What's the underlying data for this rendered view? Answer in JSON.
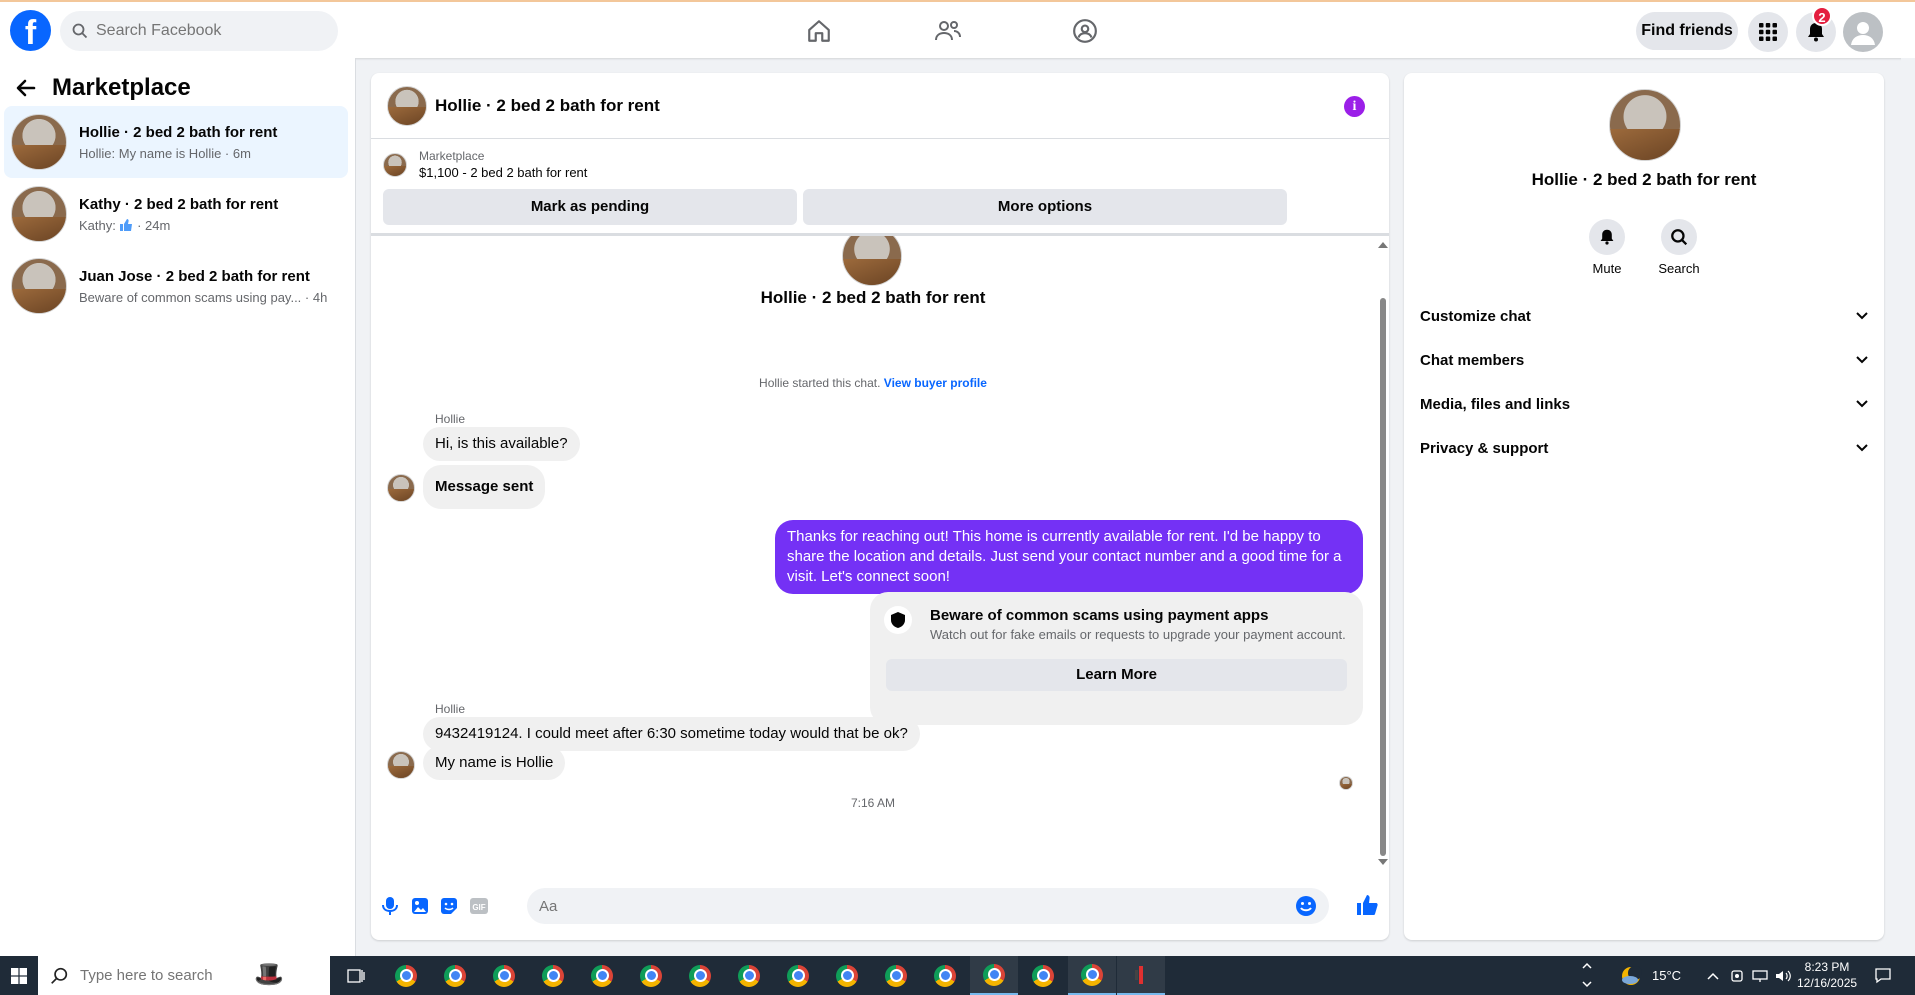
{
  "topbar": {
    "logo": "f",
    "search_placeholder": "Search Facebook",
    "find_friends": "Find friends",
    "notification_count": "2"
  },
  "sidebar": {
    "title": "Marketplace",
    "conversations": [
      {
        "title": "Hollie · 2 bed 2 bath for rent",
        "sub": "Hollie: My name is Hollie · 6m"
      },
      {
        "title": "Kathy · 2 bed 2 bath for rent",
        "sub_prefix": "Kathy:",
        "sub_suffix": "· 24m"
      },
      {
        "title": "Juan Jose · 2 bed 2 bath for rent",
        "sub": "Beware of common scams using pay...",
        "time": "· 4h"
      }
    ]
  },
  "chat": {
    "title": "Hollie · 2 bed 2 bath for rent",
    "listing_label": "Marketplace",
    "listing_price": "$1,100 - 2 bed 2 bath for rent",
    "mark_pending": "Mark as pending",
    "more_options": "More options",
    "center_title": "Hollie · 2 bed 2 bath for rent",
    "started_text": "Hollie started this chat.",
    "view_buyer": "View buyer profile",
    "sender_name": "Hollie",
    "msg1": "Hi, is this available?",
    "msg2": "Message sent",
    "outgoing": "Thanks for reaching out! This home is currently available for rent. I'd be happy to share the location and details. Just send your contact number and a good time for a visit. Let's connect soon!",
    "scam_title": "Beware of common scams using payment apps",
    "scam_desc": "Watch out for fake emails or requests to upgrade your payment account.",
    "learn_more": "Learn More",
    "timestamp": "7:16 AM",
    "sender_name2": "Hollie",
    "msg3": "9432419124. I could meet after 6:30 sometime today would that be ok?",
    "msg4": "My name is Hollie",
    "composer_placeholder": "Aa"
  },
  "rpanel": {
    "title": "Hollie · 2 bed 2 bath for rent",
    "mute": "Mute",
    "search": "Search",
    "items": [
      "Customize chat",
      "Chat members",
      "Media, files and links",
      "Privacy & support"
    ]
  },
  "taskbar": {
    "search_placeholder": "Type here to search",
    "weather": "15°C",
    "time": "8:23 PM",
    "date": "12/16/2025"
  },
  "colors": {
    "facebook_blue": "#0866ff",
    "outgoing_bubble": "#7431f5",
    "notification_red": "#e41e3f"
  }
}
